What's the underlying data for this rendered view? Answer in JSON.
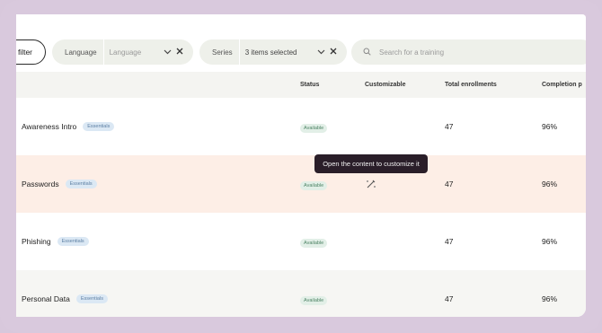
{
  "filters": {
    "add_filter_label": "filter",
    "language": {
      "label": "Language",
      "value": "Language"
    },
    "series": {
      "label": "Series",
      "value": "3 items selected"
    },
    "search": {
      "placeholder": "Search for a training"
    }
  },
  "table": {
    "headers": [
      "Status",
      "Customizable",
      "Total enrollments",
      "Completion p"
    ],
    "rows": [
      {
        "name": "Awareness Intro",
        "tag": "Essentials",
        "status": "Available",
        "enrollments": "47",
        "completion": "96%"
      },
      {
        "name": "Passwords",
        "tag": "Essentials",
        "status": "Available",
        "enrollments": "47",
        "completion": "96%"
      },
      {
        "name": "Phishing",
        "tag": "Essentials",
        "status": "Available",
        "enrollments": "47",
        "completion": "96%"
      },
      {
        "name": "Personal Data",
        "tag": "Essentials",
        "status": "Available",
        "enrollments": "47",
        "completion": "96%"
      }
    ]
  },
  "tooltip": {
    "text": "Open the content to customize it"
  },
  "icons": {
    "chevron": "chevron-down-icon",
    "clear": "close-icon",
    "search": "search-icon",
    "customize": "magic-wand-icon"
  }
}
